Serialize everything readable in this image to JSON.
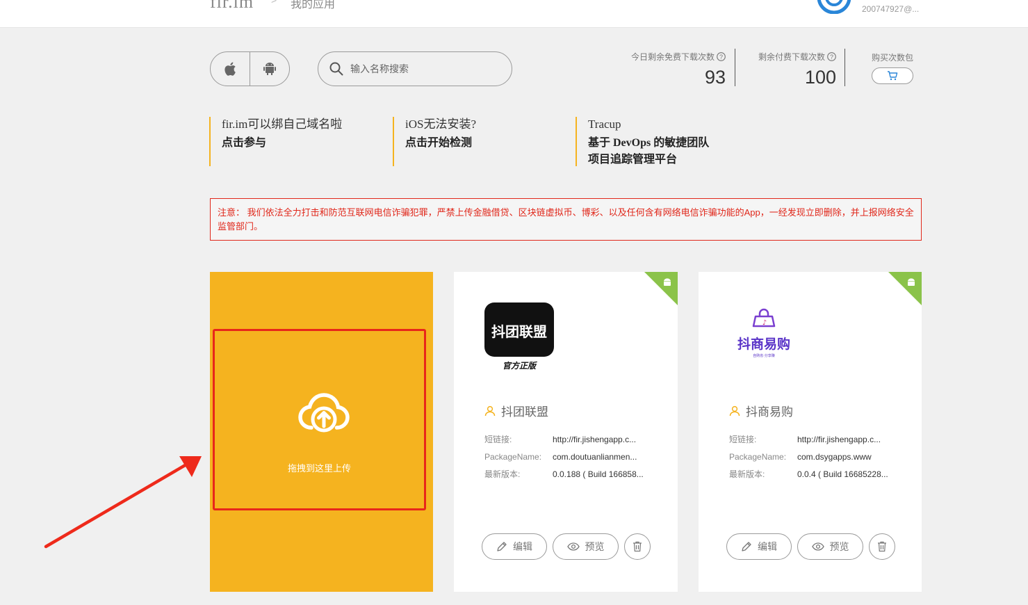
{
  "header": {
    "logo": "fir.im",
    "breadcrumb_sep": ">",
    "breadcrumb": "我的应用",
    "user_email": "200747927@..."
  },
  "search": {
    "placeholder": "输入名称搜索"
  },
  "stats": {
    "free_label": "今日剩余免费下载次数",
    "free_value": "93",
    "paid_label": "剩余付费下载次数",
    "paid_value": "100",
    "buy_label": "购买次数包"
  },
  "promos": [
    {
      "line1": "fir.im可以绑自己域名啦",
      "line2": "点击参与"
    },
    {
      "line1": "iOS无法安装?",
      "line2": "点击开始检测"
    },
    {
      "line1": "Tracup",
      "line2": "基于 DevOps 的敏捷团队",
      "line3": "项目追踪管理平台"
    }
  ],
  "notice": "注意： 我们依法全力打击和防范互联网电信诈骗犯罪，严禁上传金融借贷、区块链虚拟币、博彩、以及任何含有网络电信诈骗功能的App，一经发现立即删除，并上报网络安全监管部门。",
  "upload": {
    "text": "拖拽到这里上传"
  },
  "apps": [
    {
      "name": "抖团联盟",
      "icon_title": "抖团联盟",
      "icon_subtitle": "官方正版",
      "short_link_label": "短链接:",
      "short_link": "http://fir.jishengapp.c...",
      "package_label": "PackageName:",
      "package": "com.doutuanlianmen...",
      "version_label": "最新版本:",
      "version": "0.0.188 ( Build 166858...",
      "edit_label": "编辑",
      "preview_label": "预览"
    },
    {
      "name": "抖商易购",
      "icon_title": "抖商易购",
      "icon_subtitle": "自购省·分享赚",
      "short_link_label": "短链接:",
      "short_link": "http://fir.jishengapp.c...",
      "package_label": "PackageName:",
      "package": "com.dsygapps.www",
      "version_label": "最新版本:",
      "version": "0.0.4 ( Build 16685228...",
      "edit_label": "编辑",
      "preview_label": "预览"
    }
  ],
  "colors": {
    "accent": "#f5b31f",
    "notice_red": "#e0271a",
    "android_green": "#8bc34a"
  }
}
